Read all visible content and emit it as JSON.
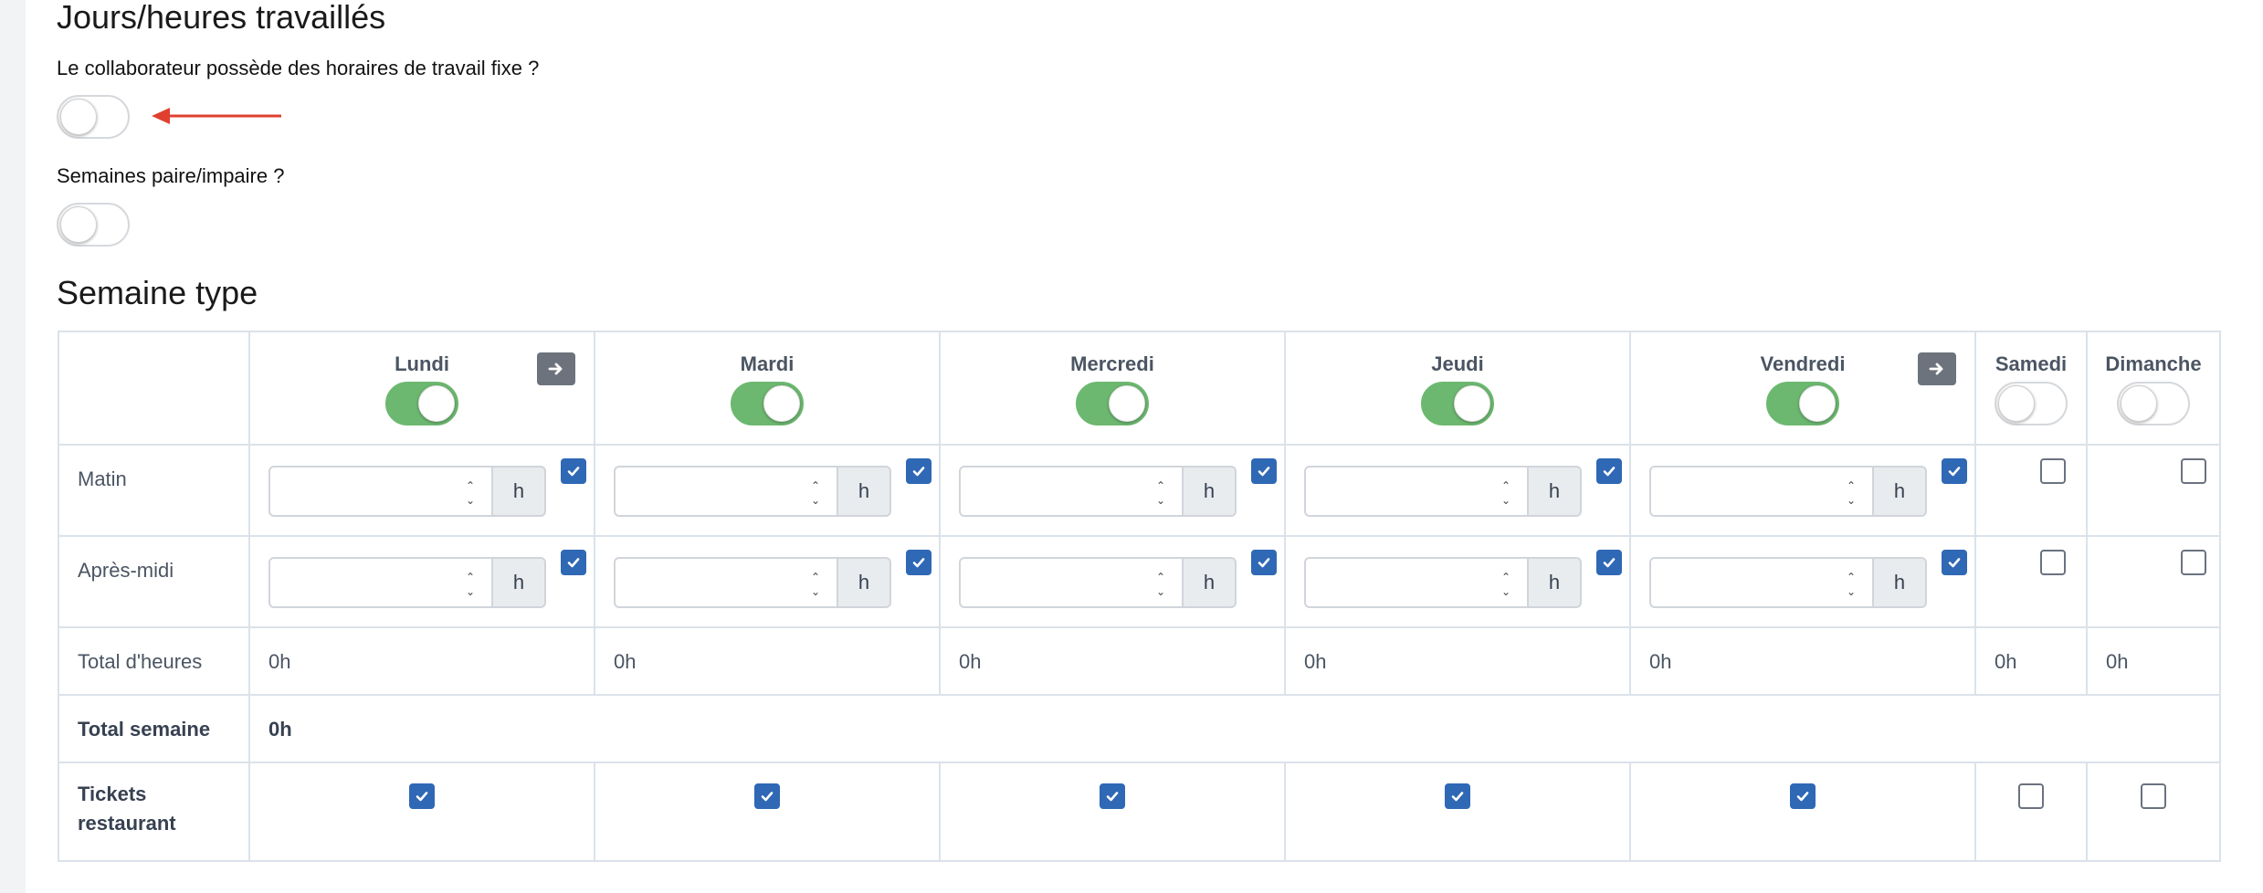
{
  "section_worked": {
    "title": "Jours/heures travaillés"
  },
  "fixed_hours": {
    "question": "Le collaborateur possède des horaires de travail fixe ?",
    "enabled": false
  },
  "even_odd": {
    "question": "Semaines paire/impaire ?",
    "enabled": false
  },
  "section_week": {
    "title": "Semaine type"
  },
  "table": {
    "days": [
      {
        "name": "Lundi",
        "enabled": true,
        "copy_button": true
      },
      {
        "name": "Mardi",
        "enabled": true,
        "copy_button": false
      },
      {
        "name": "Mercredi",
        "enabled": true,
        "copy_button": false
      },
      {
        "name": "Jeudi",
        "enabled": true,
        "copy_button": false
      },
      {
        "name": "Vendredi",
        "enabled": true,
        "copy_button": true
      },
      {
        "name": "Samedi",
        "enabled": false,
        "copy_button": false
      },
      {
        "name": "Dimanche",
        "enabled": false,
        "copy_button": false
      }
    ],
    "rows": {
      "morning": "Matin",
      "afternoon": "Après-midi",
      "total_hours": "Total d'heures",
      "total_week": "Total semaine",
      "tickets": "Tickets restaurant"
    },
    "unit": "h",
    "morning_checked": [
      true,
      true,
      true,
      true,
      true,
      false,
      false
    ],
    "afternoon_checked": [
      true,
      true,
      true,
      true,
      true,
      false,
      false
    ],
    "totals": [
      "0h",
      "0h",
      "0h",
      "0h",
      "0h",
      "0h",
      "0h"
    ],
    "week_total": "0h",
    "tickets_checked": [
      true,
      true,
      true,
      true,
      true,
      false,
      false
    ]
  },
  "colors": {
    "toggle_on": "#6cb870",
    "checkbox": "#2f68b5",
    "annotation_arrow": "#e0402f"
  }
}
